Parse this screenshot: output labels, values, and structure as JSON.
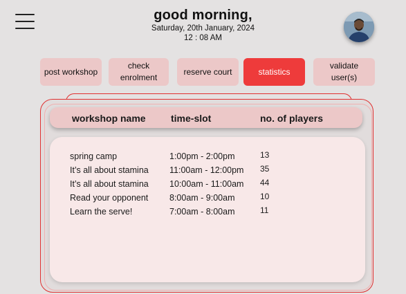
{
  "header": {
    "title": "good morning,",
    "date": "Saturday, 20th January, 2024",
    "time": "12 : 08 AM"
  },
  "nav": {
    "items": [
      {
        "label": "post workshop"
      },
      {
        "label": "check enrolment"
      },
      {
        "label": "reserve court"
      },
      {
        "label": "statistics",
        "active": true
      },
      {
        "label": "validate user(s)"
      }
    ]
  },
  "table": {
    "columns": [
      "workshop name",
      "time-slot",
      "no. of players"
    ],
    "rows": [
      {
        "name": "spring camp",
        "slot": "1:00pm - 2:00pm",
        "players": "13"
      },
      {
        "name": "It’s all about stamina",
        "slot": "11:00am - 12:00pm",
        "players": "35"
      },
      {
        "name": "It’s all about stamina",
        "slot": "10:00am - 11:00am",
        "players": "44"
      },
      {
        "name": "Read your opponent",
        "slot": "8:00am - 9:00am",
        "players": "10"
      },
      {
        "name": "Learn the serve!",
        "slot": "7:00am - 8:00am",
        "players": "11"
      }
    ]
  },
  "colors": {
    "accent": "#ee3b3b",
    "button_bg": "#ecc8c8",
    "panel_border": "#e03030",
    "background": "#e4e2e2"
  }
}
